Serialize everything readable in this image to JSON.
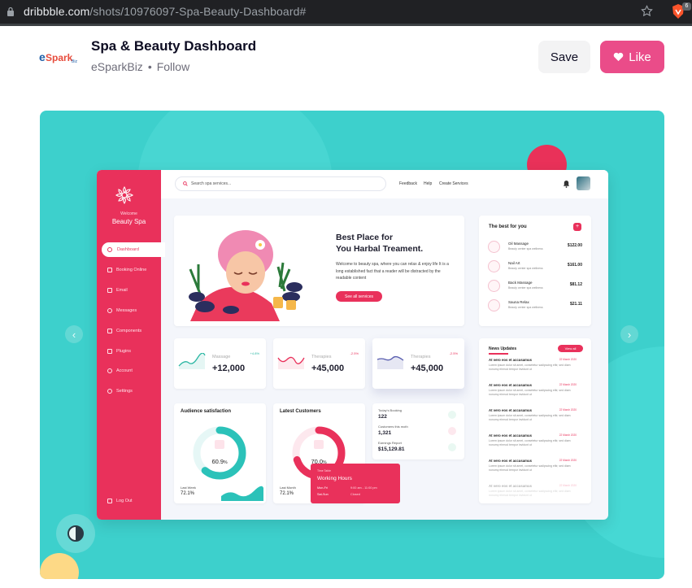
{
  "browser": {
    "url_domain": "dribbble.com",
    "url_path": "/shots/10976097-Spa-Beauty-Dashboard#",
    "extension_badge": "6"
  },
  "shot_header": {
    "title": "Spa & Beauty Dashboard",
    "author": "eSparkBiz",
    "separator": "•",
    "follow": "Follow",
    "save": "Save",
    "like": "Like",
    "logo_text": "eSpark",
    "logo_suffix": "Biz"
  },
  "colors": {
    "brand_pink": "#ea4c89",
    "spa_red": "#e9315b",
    "teal": "#3dd0cc"
  },
  "dashboard": {
    "sidebar": {
      "welcome": "Welcome",
      "spa_name": "Beauty Spa",
      "items": [
        {
          "label": "Dashboard",
          "icon": "home-icon"
        },
        {
          "label": "Booking Online",
          "icon": "calendar-icon"
        },
        {
          "label": "Email",
          "icon": "mail-icon"
        },
        {
          "label": "Messages",
          "icon": "chat-icon"
        },
        {
          "label": "Components",
          "icon": "grid-icon"
        },
        {
          "label": "Plugins",
          "icon": "plug-icon"
        },
        {
          "label": "Account",
          "icon": "user-icon"
        },
        {
          "label": "Settings",
          "icon": "gear-icon"
        }
      ],
      "logout": "Log Out"
    },
    "topbar": {
      "search_placeholder": "Search spa services...",
      "links": [
        "Feedback",
        "Help",
        "Create Services"
      ]
    },
    "hero": {
      "title_line1": "Best Place for",
      "title_line2": "You Harbal Treament.",
      "description": "Welcome to beauty spa, where you can relax & enjoy life It is a long established fact that a reader will be distracted by the readable content",
      "button": "See all services"
    },
    "best_for_you": {
      "title": "The best for you",
      "plus": "+",
      "services": [
        {
          "name": "Oil Massage",
          "sub": "Beauty center spa wellness",
          "price": "$122.00"
        },
        {
          "name": "Nail Art",
          "sub": "Beauty center spa wellness",
          "price": "$161.00"
        },
        {
          "name": "Back Massage",
          "sub": "Beauty center spa wellness",
          "price": "$81.12"
        },
        {
          "name": "Sauna Relax",
          "sub": "Beauty center spa wellness",
          "price": "$21.11"
        }
      ]
    },
    "stats": [
      {
        "label": "Massage",
        "value": "+12,000",
        "change": "+4.8%",
        "color": "#2ab7a3"
      },
      {
        "label": "Therapies",
        "value": "+45,000",
        "change": "-2.5%",
        "color": "#e9315b"
      },
      {
        "label": "Therapies",
        "value": "+45,000",
        "change": "-2.5%",
        "color": "#5a5fb0"
      }
    ],
    "audience": {
      "title": "Audience satisfaction",
      "percent": "60.9",
      "unit": "%",
      "level": 0.609,
      "foot_label": "Last Week",
      "foot_value": "72.1%"
    },
    "customers": {
      "title": "Latest Customers",
      "percent": "70.0",
      "unit": "%",
      "level": 0.7,
      "foot_label": "Last Month",
      "foot_value": "72.1%"
    },
    "mini_stats": [
      {
        "label": "Today's Booking",
        "value": "122"
      },
      {
        "label": "Customers this moth",
        "value": "1,321"
      },
      {
        "label": "Earnings Report",
        "value": "$15,129.81"
      }
    ],
    "hours": {
      "label": "Time Table",
      "title": "Working Hours",
      "rows": [
        {
          "days": "Mon-Fri",
          "time": "9:00 am - 11:00 pm"
        },
        {
          "days": "Sat-Sun",
          "time": "Closed"
        }
      ]
    },
    "news": {
      "title": "News Updates",
      "view_all": "View all",
      "items": [
        {
          "headline": "At vero eos et accusamus",
          "date": "22 March 2020",
          "body": "Lorem ipsum dolor sit amet, consetetur sadipscing elitr, sed diam nonumy eirmod tempor invidunt ut"
        },
        {
          "headline": "At vero eos et accusamus",
          "date": "22 March 2020",
          "body": "Lorem ipsum dolor sit amet, consetetur sadipscing elitr, sed diam nonumy eirmod tempor invidunt ut"
        },
        {
          "headline": "At vero eos et accusamus",
          "date": "22 March 2020",
          "body": "Lorem ipsum dolor sit amet, consetetur sadipscing elitr, sed diam nonumy eirmod tempor invidunt ut"
        },
        {
          "headline": "At vero eos et accusamus",
          "date": "22 March 2020",
          "body": "Lorem ipsum dolor sit amet, consetetur sadipscing elitr, sed diam nonumy eirmod tempor invidunt ut"
        },
        {
          "headline": "At vero eos et accusamus",
          "date": "22 March 2020",
          "body": "Lorem ipsum dolor sit amet, consetetur sadipscing elitr, sed diam nonumy eirmod tempor invidunt ut"
        },
        {
          "headline": "At vero eos et accusamus",
          "date": "22 March 2020",
          "body": "Lorem ipsum dolor sit amet, consetetur sadipscing elitr, sed diam nonumy eirmod tempor invidunt ut"
        }
      ]
    }
  }
}
